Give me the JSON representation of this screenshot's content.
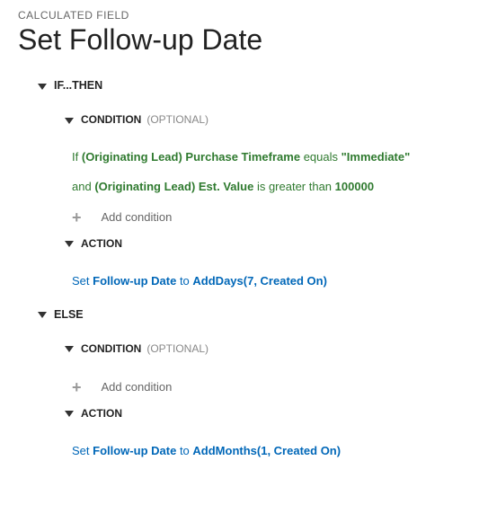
{
  "section_label": "CALCULATED FIELD",
  "title": "Set Follow-up Date",
  "ifthen": {
    "heading": "IF...THEN",
    "condition": {
      "heading": "CONDITION",
      "optional": "(OPTIONAL)",
      "lines": [
        {
          "prefix": "If",
          "field": "(Originating Lead) Purchase Timeframe",
          "operator": "equals",
          "value": "\"Immediate\""
        },
        {
          "prefix": "and",
          "field": "(Originating Lead) Est. Value",
          "operator": "is greater than",
          "value": "100000"
        }
      ],
      "add_label": "Add condition"
    },
    "action": {
      "heading": "ACTION",
      "prefix": "Set",
      "field": "Follow-up Date",
      "to": "to",
      "expr": "AddDays(7, Created On)"
    }
  },
  "else": {
    "heading": "ELSE",
    "condition": {
      "heading": "CONDITION",
      "optional": "(OPTIONAL)",
      "add_label": "Add condition"
    },
    "action": {
      "heading": "ACTION",
      "prefix": "Set",
      "field": "Follow-up Date",
      "to": "to",
      "expr": "AddMonths(1, Created On)"
    }
  }
}
